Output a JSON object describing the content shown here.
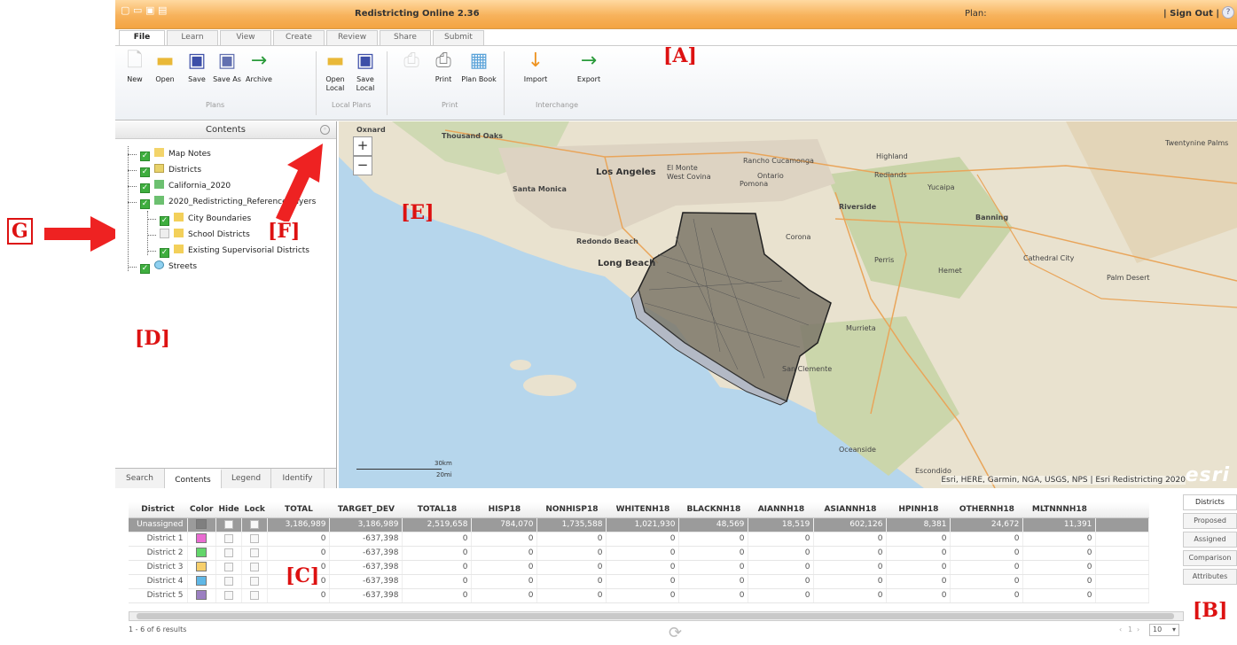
{
  "titlebar": {
    "app_title": "Redistricting Online 2.36",
    "plan_label": "Plan:",
    "signout_label": "| Sign Out |",
    "help_icon": "?"
  },
  "ribbon_tabs": [
    "File",
    "Learn",
    "View",
    "Create",
    "Review",
    "Share",
    "Submit"
  ],
  "ribbon": {
    "buttons": [
      {
        "label": "New",
        "icon": "new-document-icon"
      },
      {
        "label": "Open",
        "icon": "folder-open-icon"
      },
      {
        "label": "Save",
        "icon": "save-icon"
      },
      {
        "label": "Save As",
        "icon": "save-as-icon"
      },
      {
        "label": "Archive",
        "icon": "archive-arrow-icon"
      },
      {
        "label": "Open Local",
        "icon": "folder-open-icon"
      },
      {
        "label": "Save Local",
        "icon": "save-icon"
      },
      {
        "label": "Print",
        "icon": "print-icon"
      },
      {
        "label": "Plan Book",
        "icon": "plan-book-icon"
      },
      {
        "label": "Import",
        "icon": "import-arrow-icon"
      },
      {
        "label": "Export",
        "icon": "export-arrow-icon"
      }
    ],
    "groups": [
      "Plans",
      "Local Plans",
      "Print",
      "Interchange"
    ]
  },
  "contents_panel": {
    "title": "Contents",
    "layers": [
      {
        "label": "Map Notes",
        "checked": true
      },
      {
        "label": "Districts",
        "checked": true
      },
      {
        "label": "California_2020",
        "checked": true
      },
      {
        "label": "2020_Redistricting_Reference Layers",
        "checked": true
      },
      {
        "label": "City Boundaries",
        "checked": true
      },
      {
        "label": "School Districts",
        "checked": false
      },
      {
        "label": "Existing Supervisorial Districts",
        "checked": true
      },
      {
        "label": "Streets",
        "checked": true
      }
    ],
    "tabs": [
      "Search",
      "Contents",
      "Legend",
      "Identify"
    ]
  },
  "map": {
    "zoom_in": "+",
    "zoom_out": "−",
    "labels": [
      "Oxnard",
      "Thousand Oaks",
      "Los Angeles",
      "El Monte",
      "West Covina",
      "Pomona",
      "Rancho Cucamonga",
      "Ontario",
      "Highland",
      "Redlands",
      "Yucaipa",
      "Santa Monica",
      "Riverside",
      "Banning",
      "Redondo Beach",
      "Long Beach",
      "Corona",
      "Perris",
      "Hemet",
      "Cathedral City",
      "Palm Desert",
      "Murrieta",
      "San Clemente",
      "Oceanside",
      "Escondido",
      "Twentynine Palms"
    ],
    "attribution": "Esri, HERE, Garmin, NGA, USGS, NPS | Esri Redistricting 2020",
    "logo": "esri",
    "scale_km": "30km",
    "scale_mi": "20mi"
  },
  "table": {
    "headers": [
      "District",
      "Color",
      "Hide",
      "Lock",
      "TOTAL",
      "TARGET_DEV",
      "TOTAL18",
      "HISP18",
      "NONHISP18",
      "WHITENH18",
      "BLACKNH18",
      "AIANNH18",
      "ASIANNH18",
      "HPINH18",
      "OTHERNH18",
      "MLTNNNH18"
    ],
    "rows": [
      {
        "name": "Unassigned",
        "color": "#7f7f7f",
        "values": [
          "3,186,989",
          "3,186,989",
          "2,519,658",
          "784,070",
          "1,735,588",
          "1,021,930",
          "48,569",
          "18,519",
          "602,126",
          "8,381",
          "24,672",
          "11,391"
        ]
      },
      {
        "name": "District 1",
        "color": "#e96bd1",
        "values": [
          "0",
          "-637,398",
          "0",
          "0",
          "0",
          "0",
          "0",
          "0",
          "0",
          "0",
          "0",
          "0"
        ]
      },
      {
        "name": "District 2",
        "color": "#62d66a",
        "values": [
          "0",
          "-637,398",
          "0",
          "0",
          "0",
          "0",
          "0",
          "0",
          "0",
          "0",
          "0",
          "0"
        ]
      },
      {
        "name": "District 3",
        "color": "#f7cf6b",
        "values": [
          "0",
          "-637,398",
          "0",
          "0",
          "0",
          "0",
          "0",
          "0",
          "0",
          "0",
          "0",
          "0"
        ]
      },
      {
        "name": "District 4",
        "color": "#5fb7e6",
        "values": [
          "0",
          "-637,398",
          "0",
          "0",
          "0",
          "0",
          "0",
          "0",
          "0",
          "0",
          "0",
          "0"
        ]
      },
      {
        "name": "District 5",
        "color": "#9b7fc1",
        "values": [
          "0",
          "-637,398",
          "0",
          "0",
          "0",
          "0",
          "0",
          "0",
          "0",
          "0",
          "0",
          "0"
        ]
      }
    ],
    "side_tabs": [
      "Districts",
      "Proposed",
      "Assigned",
      "Comparison",
      "Attributes"
    ],
    "results_text": "1 - 6 of 6 results",
    "page_text": "1",
    "page_size": "10"
  },
  "annotations": {
    "A": "[A]",
    "B": "[B]",
    "C": "[C]",
    "D": "[D]",
    "E": "[E]",
    "F": "[F]",
    "G": "G"
  }
}
